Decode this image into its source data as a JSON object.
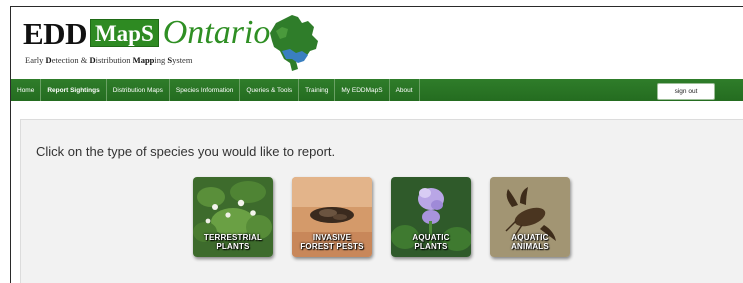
{
  "brand": {
    "edd": "EDD",
    "maps": "MapS",
    "ontario": "Ontario",
    "tagline_parts": [
      "Early ",
      "D",
      "etection & ",
      "D",
      "istribution ",
      "Mapp",
      "ing ",
      "S",
      "ystem"
    ]
  },
  "nav": {
    "items": [
      {
        "label": "Home",
        "bold": false
      },
      {
        "label": "Report Sightings",
        "bold": true
      },
      {
        "label": "Distribution Maps",
        "bold": false
      },
      {
        "label": "Species Information",
        "bold": false
      },
      {
        "label": "Queries & Tools",
        "bold": false
      },
      {
        "label": "Training",
        "bold": false
      },
      {
        "label": "My EDDMapS",
        "bold": false
      },
      {
        "label": "About",
        "bold": false
      }
    ],
    "sign_out": "sign out"
  },
  "main": {
    "prompt": "Click on the type of species you would like to report.",
    "tiles": [
      {
        "line1": "Terrestrial",
        "line2": "Plants",
        "icon": "terrestrial-plants-icon"
      },
      {
        "line1": "Invasive",
        "line2": "Forest Pests",
        "icon": "forest-pests-icon"
      },
      {
        "line1": "Aquatic",
        "line2": "Plants",
        "icon": "aquatic-plants-icon"
      },
      {
        "line1": "Aquatic",
        "line2": "Animals",
        "icon": "aquatic-animals-icon"
      }
    ]
  },
  "colors": {
    "nav_green": "#2a7524",
    "brand_green": "#2e8a22",
    "content_bg": "#f2f2f2"
  }
}
